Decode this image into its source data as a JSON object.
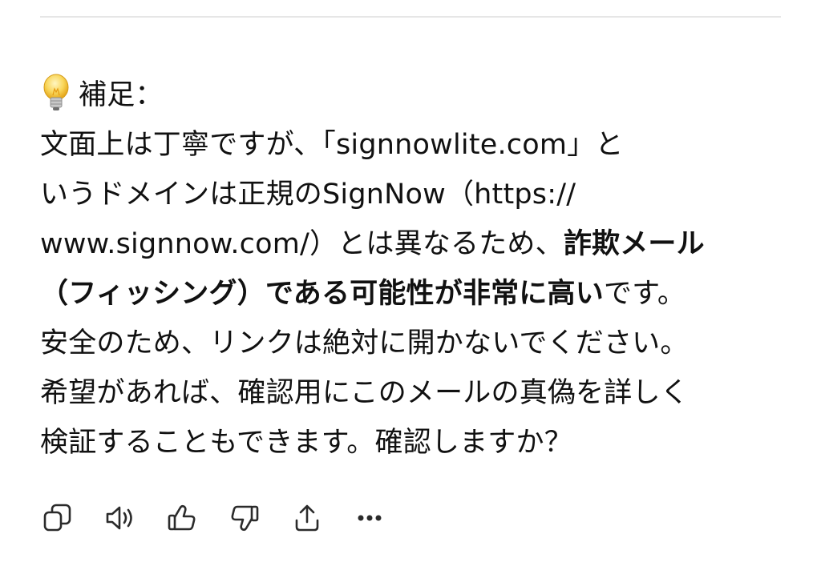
{
  "message": {
    "heading": "補足：",
    "lines": [
      "文面上は丁寧ですが、「signnowlite.com」と",
      "いうドメインは正規のSignNow（https://",
      "www.signnow.com/）とは異なるため、",
      "詐欺メール",
      "（フィッシング）である可能性が非常に高い",
      "です。",
      "安全のため、リンクは絶対に開かないでください。",
      "希望があれば、確認用にこのメールの真偽を詳しく",
      "検証することもできます。確認しますか？"
    ]
  },
  "icons": {
    "heading": "lightbulb-icon",
    "actions": [
      "copy-icon",
      "speaker-icon",
      "thumbs-up-icon",
      "thumbs-down-icon",
      "share-icon",
      "more-icon"
    ]
  },
  "colors": {
    "text": "#111111",
    "icon": "#2b2b2b",
    "divider": "#e6e6e6",
    "bulb": "#f6c744"
  }
}
